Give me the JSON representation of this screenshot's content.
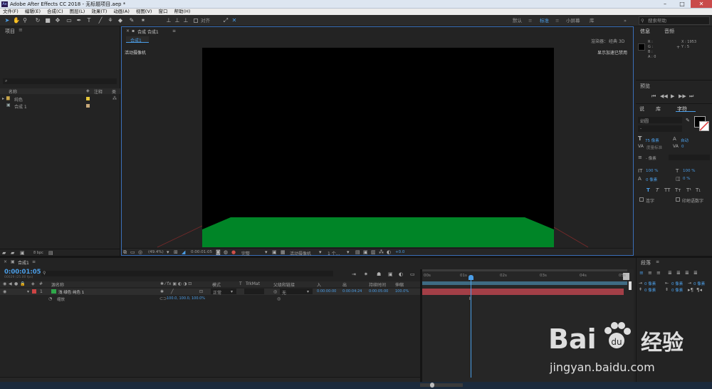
{
  "window": {
    "title": "Adobe After Effects CC 2018 - 无标题项目.aep *",
    "app_icon": "Ae"
  },
  "menu": [
    "文件(F)",
    "编辑(E)",
    "合成(C)",
    "图层(L)",
    "效果(T)",
    "动画(A)",
    "视图(V)",
    "窗口",
    "帮助(H)"
  ],
  "toolbar": {
    "align_label": "对齐",
    "workspaces": [
      "默认",
      "标准",
      "小屏幕",
      "库"
    ],
    "active_workspace": "标准",
    "search_placeholder": "搜索帮助"
  },
  "project": {
    "title": "项目",
    "search_icon": "⌕",
    "columns": {
      "name": "名称",
      "comment": "注释",
      "type": "类"
    },
    "items": [
      {
        "name": "纯色",
        "kind": "folder",
        "color": "#e6c63a"
      },
      {
        "name": "合成 1",
        "kind": "comp",
        "color": "#c8a97a"
      }
    ],
    "bpc": "8 bpc"
  },
  "comp_viewer": {
    "panel_title": "合成 合成1",
    "tab": "合成1",
    "renderer_label": "渲染器：",
    "renderer_value": "经典 3D",
    "camera_label": "活动摄像机",
    "accel_label": "显示加速已禁用",
    "zoom": "(49.4%)",
    "timecode": "0:00:01:05",
    "resolution": "完整",
    "view": "活动摄像机",
    "views_count": "1 个...",
    "exposure": "+0.0"
  },
  "info": {
    "tab": "信息",
    "tab2": "音频",
    "r": "R :",
    "g": "G :",
    "b": "B :",
    "a": "A : 0",
    "x": "X : 1953",
    "y": "Y : 5"
  },
  "preview": {
    "title": "预览"
  },
  "character": {
    "tabs": [
      "说",
      "库",
      "字符"
    ],
    "font_family": "幼圆",
    "font_style": "-",
    "size": "75 像素",
    "leading": "自动",
    "kerning": "度量标准",
    "tracking": "0",
    "stroke": "- 像素",
    "vscale": "100 %",
    "hscale": "100 %",
    "baseline": "0 像素",
    "tsume": "0 %",
    "style_buttons": [
      "T",
      "T",
      "TT",
      "Tт",
      "T¹",
      "T₁"
    ],
    "ligature": "连字",
    "hindi": "印地语数字"
  },
  "timeline": {
    "tab": "合成1",
    "timecode": "0:00:01:05",
    "fps_note": "00029 (25.00 fps)",
    "columns": {
      "source": "源名称",
      "mode": "模式",
      "trkmat": "TrkMat",
      "parent": "父级和链接",
      "in": "入",
      "out": "出",
      "duration": "持续时间",
      "stretch": "伸缩"
    },
    "layers": [
      {
        "num": "1",
        "name": "浅 绿色 纯色 1",
        "color": "#2fa84a",
        "mode": "正常",
        "parent": "无",
        "in": "0:00:00:00",
        "out": "0:00:04:24",
        "duration": "0:00:05:00",
        "stretch": "100.0%"
      }
    ],
    "property": {
      "name": "缩放",
      "value": "100.0, 100.0, 100.0%"
    },
    "ruler": [
      "00s",
      "01s",
      "02s",
      "03s",
      "04s",
      "05s"
    ],
    "playhead_time": "01:05"
  },
  "paragraph": {
    "title": "段落",
    "values": [
      "0 像素",
      "0 像素",
      "0 像素",
      "0 像素",
      "0 像素"
    ]
  },
  "colors": {
    "accent_blue": "#4b9ee8",
    "layer_bar": "#a33f47",
    "solid_green": "#008527"
  },
  "watermark": {
    "brand": "Bai",
    "brand2": "du",
    "label": "经验",
    "url": "jingyan.baidu.com"
  }
}
